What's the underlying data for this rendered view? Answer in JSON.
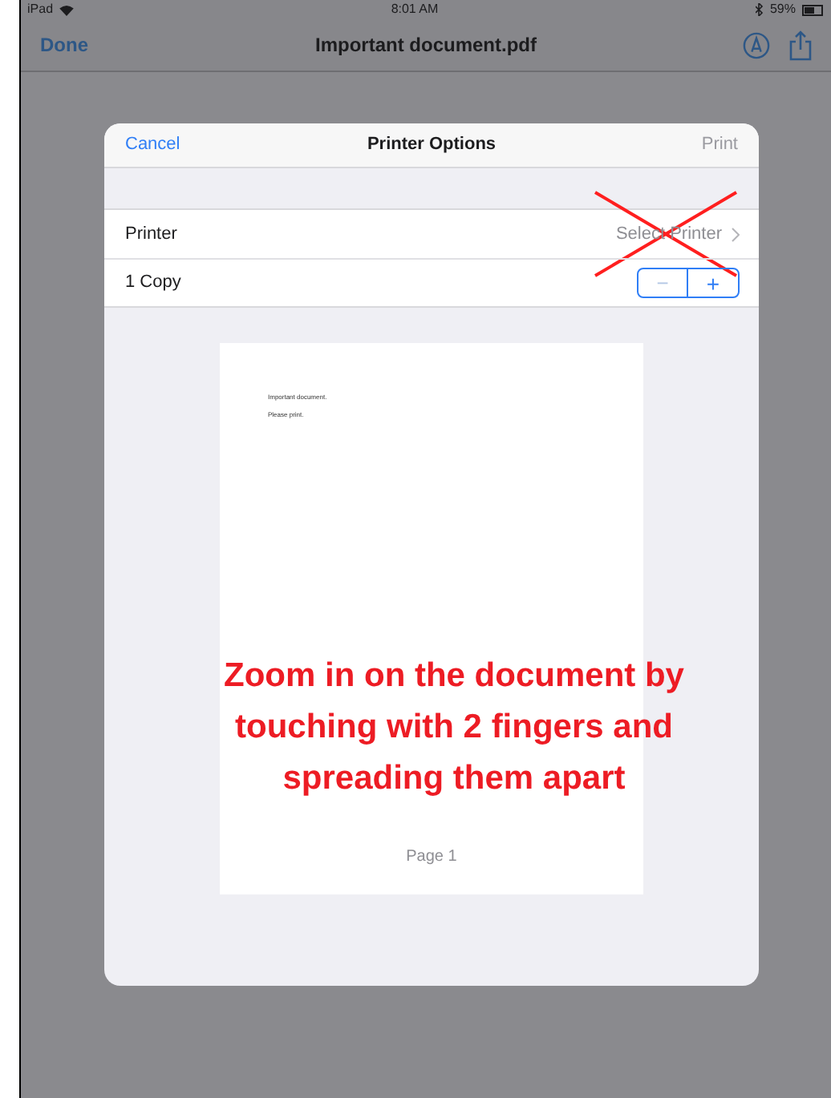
{
  "status_bar": {
    "device": "iPad",
    "time": "8:01 AM",
    "battery": "59%"
  },
  "nav_bar": {
    "back": "Done",
    "title": "Important document.pdf"
  },
  "dialog": {
    "cancel": "Cancel",
    "title": "Printer Options",
    "print": {
      "label": "Print",
      "disabled": true
    },
    "rows": [
      {
        "kind": "link",
        "label": "Printer",
        "value": "Select Printer",
        "crossed_out": true
      },
      {
        "kind": "stepper",
        "label": "1 Copy",
        "minus": {
          "label": "−",
          "disabled": true
        },
        "plus": {
          "label": "+",
          "disabled": false
        }
      }
    ],
    "preview": {
      "lines": [
        "Important document.",
        "Please print."
      ],
      "page_label": "Page 1"
    }
  },
  "annotation": "Zoom in on the document by touching with 2 fingers and spreading them apart"
}
